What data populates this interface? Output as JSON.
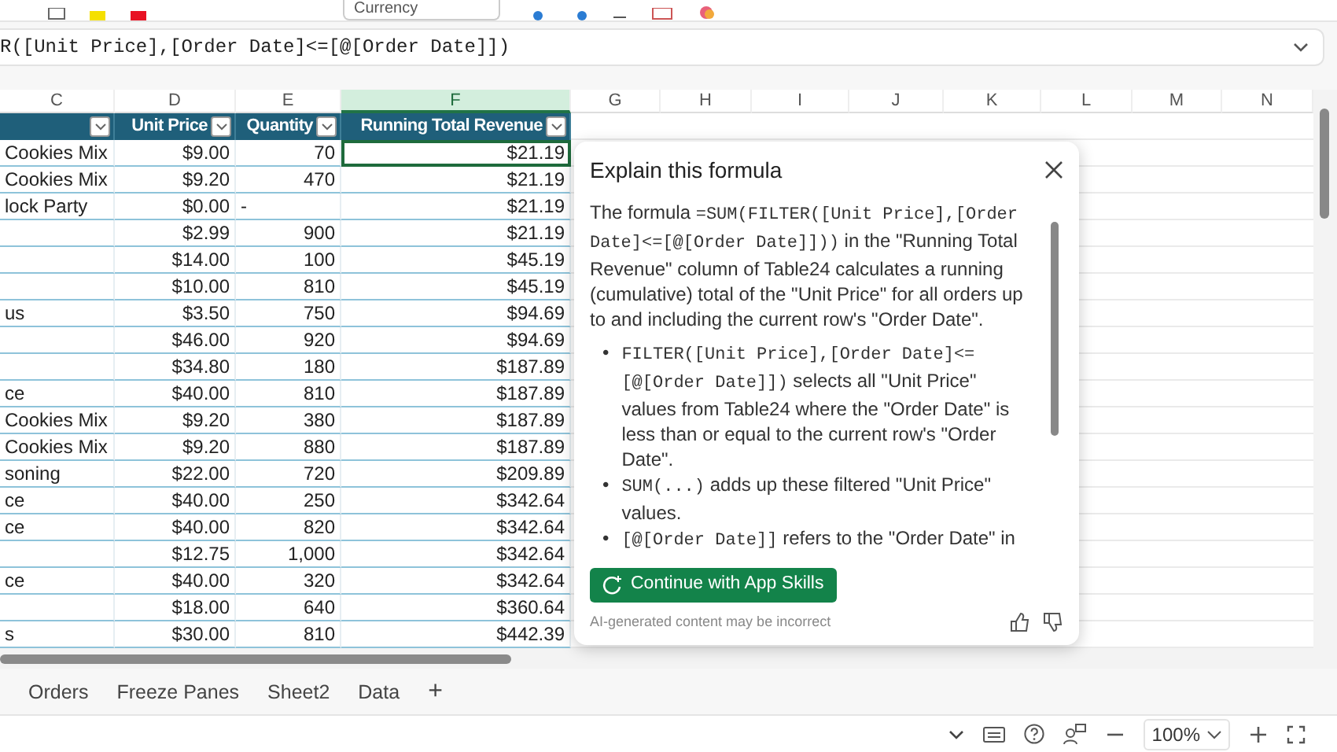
{
  "ribbon": {
    "number_format": "Currency"
  },
  "formula_bar": {
    "text": "R([Unit Price],[Order Date]<=[@[Order Date]])"
  },
  "columns": [
    {
      "letter": "C",
      "selected": false
    },
    {
      "letter": "D",
      "selected": false
    },
    {
      "letter": "E",
      "selected": false
    },
    {
      "letter": "F",
      "selected": true
    },
    {
      "letter": "G",
      "selected": false
    },
    {
      "letter": "H",
      "selected": false
    },
    {
      "letter": "I",
      "selected": false
    },
    {
      "letter": "J",
      "selected": false
    },
    {
      "letter": "K",
      "selected": false
    },
    {
      "letter": "L",
      "selected": false
    },
    {
      "letter": "M",
      "selected": false
    },
    {
      "letter": "N",
      "selected": false
    }
  ],
  "table": {
    "headers": [
      {
        "filter": true
      },
      {
        "label": "Unit Price",
        "filter": true
      },
      {
        "label": "Quantity",
        "filter": true
      },
      {
        "label": "Running Total Revenue",
        "filter": true
      }
    ],
    "rows": [
      {
        "item": "Cookies Mix",
        "unit_price": "$9.00",
        "quantity": "70",
        "running_total": "$21.19",
        "selected": true
      },
      {
        "item": "Cookies Mix",
        "unit_price": "$9.20",
        "quantity": "470",
        "running_total": "$21.19",
        "selected": false
      },
      {
        "item": "lock Party",
        "unit_price": "$0.00",
        "quantity": "-",
        "running_total": "$21.19",
        "selected": false
      },
      {
        "unit_price": "$2.99",
        "quantity": "900",
        "running_total": "$21.19",
        "selected": false
      },
      {
        "unit_price": "$14.00",
        "quantity": "100",
        "running_total": "$45.19",
        "selected": false
      },
      {
        "unit_price": "$10.00",
        "quantity": "810",
        "running_total": "$45.19",
        "selected": false
      },
      {
        "item": "us",
        "unit_price": "$3.50",
        "quantity": "750",
        "running_total": "$94.69",
        "selected": false
      },
      {
        "unit_price": "$46.00",
        "quantity": "920",
        "running_total": "$94.69",
        "selected": false
      },
      {
        "unit_price": "$34.80",
        "quantity": "180",
        "running_total": "$187.89",
        "selected": false
      },
      {
        "item": "ce",
        "unit_price": "$40.00",
        "quantity": "810",
        "running_total": "$187.89",
        "selected": false
      },
      {
        "item": "Cookies Mix",
        "unit_price": "$9.20",
        "quantity": "380",
        "running_total": "$187.89",
        "selected": false
      },
      {
        "item": "Cookies Mix",
        "unit_price": "$9.20",
        "quantity": "880",
        "running_total": "$187.89",
        "selected": false
      },
      {
        "item": "soning",
        "unit_price": "$22.00",
        "quantity": "720",
        "running_total": "$209.89",
        "selected": false
      },
      {
        "item": "ce",
        "unit_price": "$40.00",
        "quantity": "250",
        "running_total": "$342.64",
        "selected": false
      },
      {
        "item": "ce",
        "unit_price": "$40.00",
        "quantity": "820",
        "running_total": "$342.64",
        "selected": false
      },
      {
        "unit_price": "$12.75",
        "quantity": "1,000",
        "running_total": "$342.64",
        "selected": false
      },
      {
        "item": "ce",
        "unit_price": "$40.00",
        "quantity": "320",
        "running_total": "$342.64",
        "selected": false
      },
      {
        "unit_price": "$18.00",
        "quantity": "640",
        "running_total": "$360.64",
        "selected": false
      },
      {
        "item": "s",
        "unit_price": "$30.00",
        "quantity": "810",
        "running_total": "$442.39",
        "selected": false
      }
    ]
  },
  "explain_panel": {
    "title": "Explain this formula",
    "paragraph": [
      {
        "kind": "text",
        "text": "The formula "
      },
      {
        "kind": "code",
        "text": "=SUM(FILTER([Unit Price],[Order Date]<=[@[Order Date]]))"
      },
      {
        "kind": "text",
        "text": " in the \"Running Total Revenue\" column of Table24 calculates a running (cumulative) total of the \"Unit Price\" for all orders up to and including the current row's \"Order Date\"."
      }
    ],
    "bullets": [
      {
        "marker": "•",
        "segments": [
          {
            "kind": "code",
            "text": "FILTER([Unit Price],[Order Date]<= [@[Order Date]])"
          },
          {
            "kind": "text",
            "text": " selects all \"Unit Price\" values from Table24 where the \"Order Date\" is less than or equal to the current row's \"Order Date\"."
          }
        ]
      },
      {
        "marker": "•",
        "segments": [
          {
            "kind": "code",
            "text": "SUM(...)"
          },
          {
            "kind": "text",
            "text": " adds up these filtered \"Unit Price\" values."
          }
        ]
      },
      {
        "marker": "•",
        "segments": [
          {
            "kind": "code",
            "text": "[@[Order Date]]"
          },
          {
            "kind": "text",
            "text": " refers to the \"Order Date\" in"
          }
        ]
      }
    ],
    "action": "Continue with App Skills",
    "disclaimer": "AI-generated content may be incorrect"
  },
  "sheet_tabs": [
    {
      "label": "Orders"
    },
    {
      "label": "Freeze Panes"
    },
    {
      "label": "Sheet2"
    },
    {
      "label": "Data"
    }
  ],
  "add_sheet": "+",
  "status_bar": {
    "zoom": "100%"
  }
}
